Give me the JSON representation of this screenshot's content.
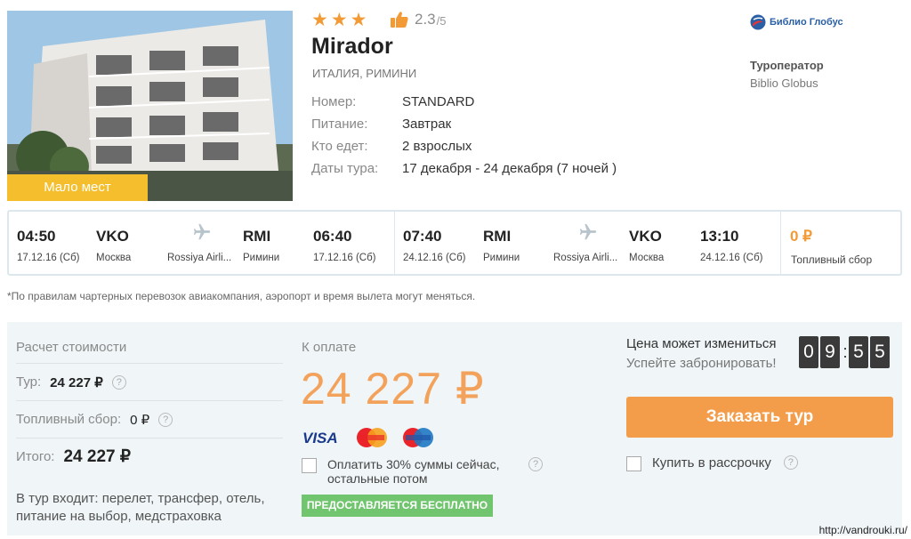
{
  "hotel": {
    "stars": "★★★",
    "rating": "2.3",
    "rating_max": "/5",
    "name": "Mirador",
    "location": "ИТАЛИЯ, РИМИНИ",
    "badge": "Мало мест",
    "details": [
      {
        "label": "Номер:",
        "value": "STANDARD"
      },
      {
        "label": "Питание:",
        "value": "Завтрак"
      },
      {
        "label": "Кто едет:",
        "value": "2 взрослых"
      },
      {
        "label": "Даты тура:",
        "value": "17 декабря - 24 декабря (7 ночей )"
      }
    ]
  },
  "operator": {
    "logo_text": "Библио Глобус",
    "label": "Туроператор",
    "name": "Biblio Globus"
  },
  "flights": {
    "outbound": {
      "dep_time": "04:50",
      "dep_date": "17.12.16 (Сб)",
      "dep_code": "VKO",
      "dep_city": "Москва",
      "airline": "Rossiya Airli...",
      "arr_code": "RMI",
      "arr_city": "Римини",
      "arr_time": "06:40",
      "arr_date": "17.12.16 (Сб)"
    },
    "return": {
      "dep_time": "07:40",
      "dep_date": "24.12.16 (Сб)",
      "dep_code": "RMI",
      "dep_city": "Римини",
      "airline": "Rossiya Airli...",
      "arr_code": "VKO",
      "arr_city": "Москва",
      "arr_time": "13:10",
      "arr_date": "24.12.16 (Сб)"
    },
    "fuel_amount": "0 ₽",
    "fuel_label": "Топливный сбор"
  },
  "footnote": "*По правилам чартерных перевозок авиакомпания, аэропорт и время вылета могут меняться.",
  "calc": {
    "title": "Расчет стоимости",
    "tour_label": "Тур:",
    "tour_value": "24 227 ₽",
    "fuel_label": "Топливный сбор:",
    "fuel_value": "0 ₽",
    "total_label": "Итого:",
    "total_value": "24 227 ₽",
    "includes": "В тур входит: перелет, трансфер, отель, питание на выбор, медстраховка"
  },
  "payment": {
    "title": "К оплате",
    "amount": "24 227 ₽",
    "cards": [
      "VISA",
      "MasterCard",
      "Maestro"
    ],
    "partial_label": "Оплатить 30% суммы сейчас, остальные потом",
    "free_badge": "ПРЕДОСТАВЛЯЕТСЯ БЕСПЛАТНО"
  },
  "booking": {
    "price_change": "Цена может измениться",
    "hurry": "Успейте забронировать!",
    "timer_digits": [
      "0",
      "9",
      "5",
      "5"
    ],
    "order_button": "Заказать тур",
    "installment_label": "Купить в рассрочку"
  },
  "watermark": "http://vandrouki.ru/",
  "colors": {
    "accent_orange": "#f39d4a",
    "badge_yellow": "#f4be2d",
    "free_green": "#70c56e",
    "panel_bg": "#f0f5f7"
  }
}
